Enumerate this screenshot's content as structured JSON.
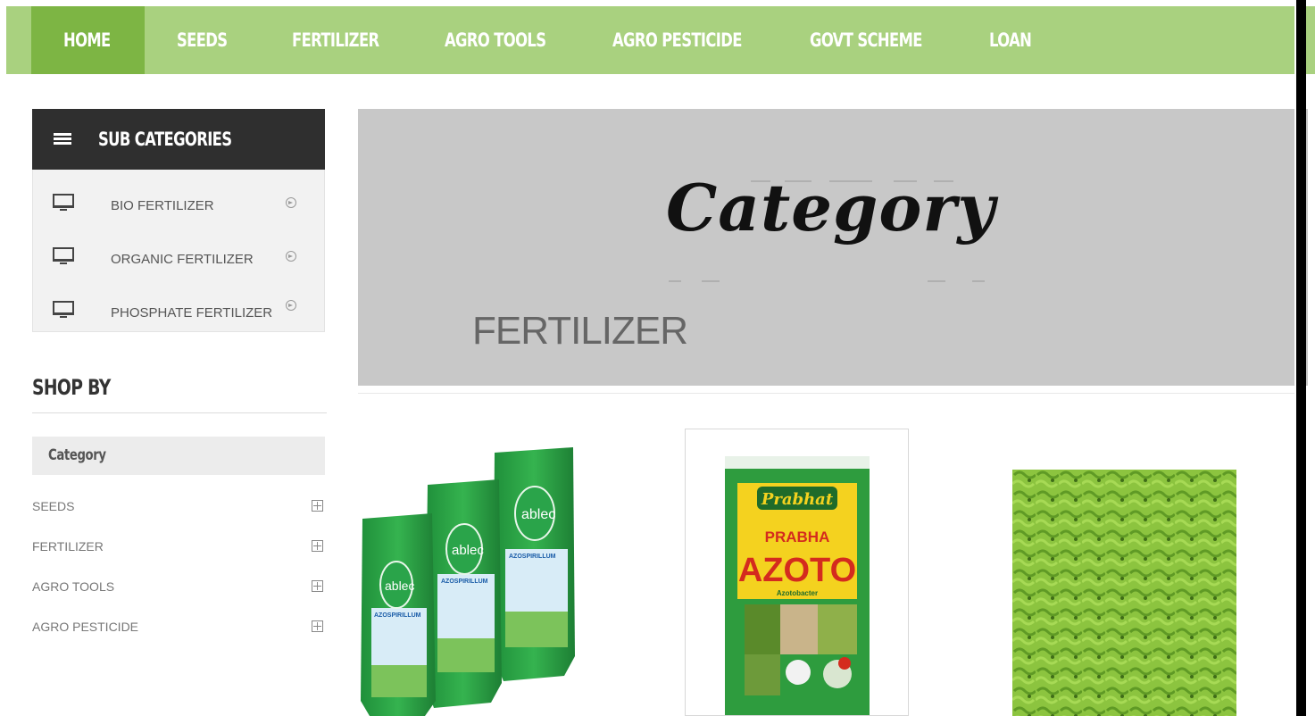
{
  "nav": {
    "items": [
      {
        "label": "HOME",
        "active": true
      },
      {
        "label": "SEEDS"
      },
      {
        "label": "FERTILIZER"
      },
      {
        "label": "AGRO TOOLS"
      },
      {
        "label": "AGRO PESTICIDE"
      },
      {
        "label": "GOVT SCHEME"
      },
      {
        "label": "LOAN"
      }
    ]
  },
  "sidebar": {
    "sub_categories_title": "SUB CATEGORIES",
    "sub_categories": [
      {
        "label": "BIO FERTILIZER"
      },
      {
        "label": "ORGANIC FERTILIZER"
      },
      {
        "label": "PHOSPHATE FERTILIZER"
      }
    ],
    "shop_by_title": "SHOP BY",
    "category_box_label": "Category",
    "categories": [
      {
        "label": "SEEDS"
      },
      {
        "label": "FERTILIZER"
      },
      {
        "label": "AGRO TOOLS"
      },
      {
        "label": "AGRO PESTICIDE"
      }
    ]
  },
  "banner": {
    "script_text": "Category",
    "title": "FERTILIZER"
  },
  "products": [
    {
      "brand_text": "ablec",
      "product_text": "AZOSPIRILLUM"
    },
    {
      "brand_text": "Prabhat",
      "product_line": "PRABHA",
      "product_name": "AZOTO",
      "sub_text": "Azotobacter"
    },
    {
      "brand_text": ""
    }
  ],
  "colors": {
    "nav_bg": "#a9d17f",
    "nav_active": "#7db544",
    "sidebar_header": "#2f2f2f",
    "banner_bg": "#c8c8c8"
  }
}
